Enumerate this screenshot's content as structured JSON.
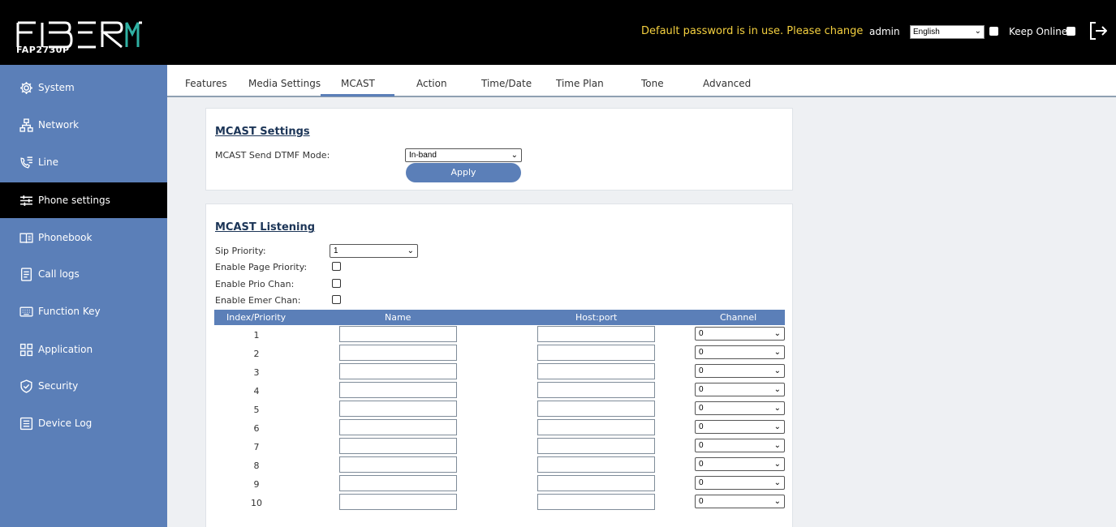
{
  "header": {
    "model": "FAP2730P",
    "warning": "Default password is in use. Please change",
    "user": "admin",
    "language": "English",
    "keep_online": "Keep Online"
  },
  "sidebar": {
    "items": [
      {
        "label": "System",
        "icon": "gear-icon"
      },
      {
        "label": "Network",
        "icon": "network-icon"
      },
      {
        "label": "Line",
        "icon": "phone-list-icon"
      },
      {
        "label": "Phone settings",
        "icon": "sliders-icon",
        "active": true
      },
      {
        "label": "Phonebook",
        "icon": "book-icon"
      },
      {
        "label": "Call logs",
        "icon": "document-icon"
      },
      {
        "label": "Function Key",
        "icon": "keyboard-icon"
      },
      {
        "label": "Application",
        "icon": "grid-icon"
      },
      {
        "label": "Security",
        "icon": "shield-icon"
      },
      {
        "label": "Device Log",
        "icon": "log-icon"
      }
    ]
  },
  "tabs": [
    "Features",
    "Media Settings",
    "MCAST",
    "Action",
    "Time/Date",
    "Time Plan",
    "Tone",
    "Advanced"
  ],
  "active_tab": "MCAST",
  "mcast_settings": {
    "title": "MCAST Settings",
    "dtmf_label": "MCAST Send DTMF Mode:",
    "dtmf_value": "In-band",
    "apply": "Apply"
  },
  "mcast_listening": {
    "title": "MCAST Listening",
    "sip_priority_label": "Sip Priority:",
    "sip_priority_value": "1",
    "page_priority_label": "Enable Page Priority:",
    "prio_chan_label": "Enable Prio Chan:",
    "emer_chan_label": "Enable Emer Chan:",
    "columns": [
      "Index/Priority",
      "Name",
      "Host:port",
      "Channel"
    ],
    "rows": [
      {
        "index": "1",
        "name": "",
        "host": "",
        "channel": "0"
      },
      {
        "index": "2",
        "name": "",
        "host": "",
        "channel": "0"
      },
      {
        "index": "3",
        "name": "",
        "host": "",
        "channel": "0"
      },
      {
        "index": "4",
        "name": "",
        "host": "",
        "channel": "0"
      },
      {
        "index": "5",
        "name": "",
        "host": "",
        "channel": "0"
      },
      {
        "index": "6",
        "name": "",
        "host": "",
        "channel": "0"
      },
      {
        "index": "7",
        "name": "",
        "host": "",
        "channel": "0"
      },
      {
        "index": "8",
        "name": "",
        "host": "",
        "channel": "0"
      },
      {
        "index": "9",
        "name": "",
        "host": "",
        "channel": "0"
      },
      {
        "index": "10",
        "name": "",
        "host": "",
        "channel": "0"
      }
    ]
  },
  "colors": {
    "header_bg": "#000000",
    "sidebar_bg": "#5b7fb8",
    "active_item_bg": "#000000",
    "warning_text": "#f4d03f",
    "accent": "#5b7fb8"
  }
}
